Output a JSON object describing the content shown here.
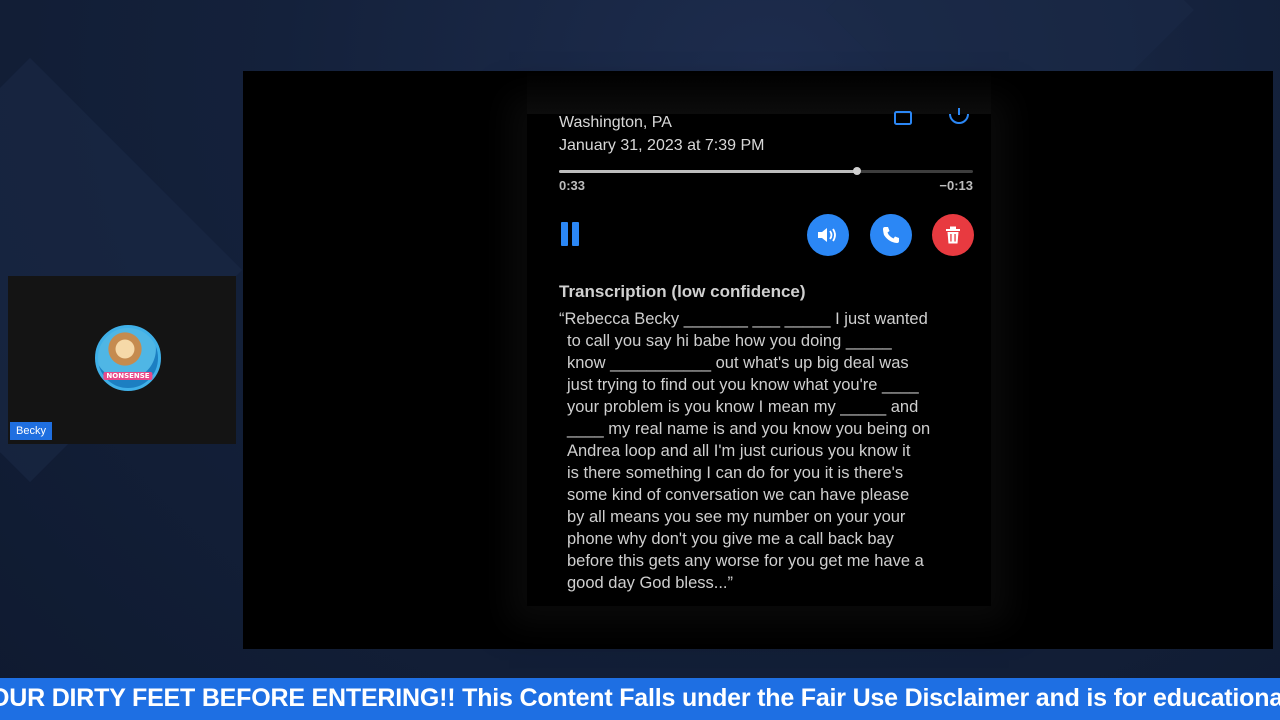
{
  "webcam": {
    "name": "Becky",
    "avatar_badge": "NONSENSE"
  },
  "voicemail": {
    "location": "Washington, PA",
    "date": "January 31, 2023 at 7:39 PM",
    "progress": 0.72,
    "elapsed": "0:33",
    "remaining": "−0:13",
    "transcription_title": "Transcription (low confidence)",
    "transcription": "“Rebecca Becky _______ ___ _____ I just wanted\nto call you say hi babe how you doing _____\nknow ___________ out what's up big deal was\njust trying to find out you know what you're ____\nyour problem is you know I mean my _____ and\n____ my real name is and you know you being on\nAndrea loop and all I'm just curious you know it\nis there something I can do for you it is there's\nsome kind of conversation we can have please\nby all means you see my number on your your\nphone why don't you give me a call back bay\nbefore this gets any worse for you get me have a\ngood day God bless...”",
    "colors": {
      "accent": "#2b87f5",
      "delete": "#e83a40"
    },
    "icons": [
      "share-icon",
      "info-icon",
      "pause-icon",
      "speaker-icon",
      "phone-icon",
      "trash-icon"
    ]
  },
  "ticker": {
    "text": "OUR DIRTY FEET BEFORE ENTERING!! This Content Falls under the Fair Use Disclaimer and is for educational"
  }
}
